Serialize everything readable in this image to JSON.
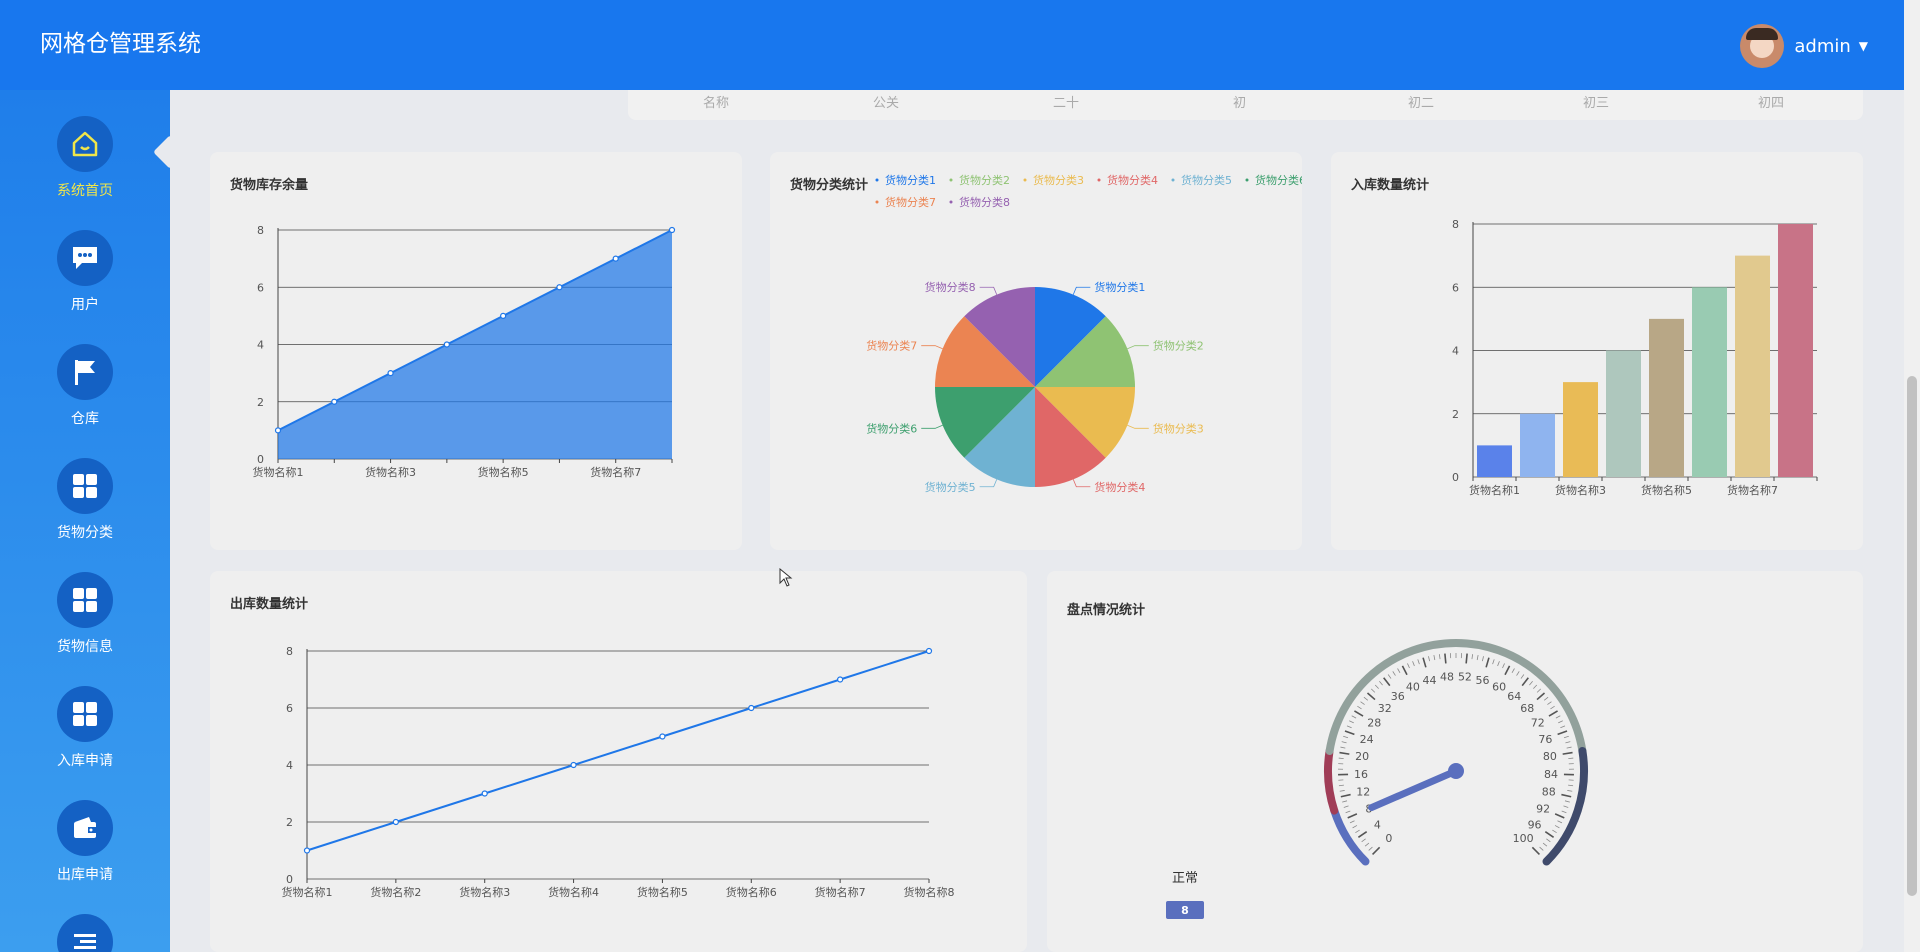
{
  "app": {
    "title": "网格仓管理系统"
  },
  "user": {
    "name": "admin"
  },
  "nav": [
    {
      "label": "系统首页",
      "icon": "home-icon",
      "active": true
    },
    {
      "label": "用户",
      "icon": "chat-icon"
    },
    {
      "label": "仓库",
      "icon": "flag-icon"
    },
    {
      "label": "货物分类",
      "icon": "grid-icon"
    },
    {
      "label": "货物信息",
      "icon": "grid-icon"
    },
    {
      "label": "入库申请",
      "icon": "grid-icon"
    },
    {
      "label": "出库申请",
      "icon": "wallet-icon"
    }
  ],
  "topcard": {
    "cells": [
      "名称",
      "公关",
      "二十",
      "初",
      "初二",
      "初三",
      "初四"
    ]
  },
  "charts": {
    "stock": {
      "title": "货物库存余量"
    },
    "category": {
      "title": "货物分类统计"
    },
    "inbound": {
      "title": "入库数量统计"
    },
    "outbound": {
      "title": "出库数量统计"
    },
    "inventory": {
      "title": "盘点情况统计"
    }
  },
  "chart_data": [
    {
      "type": "area",
      "title": "货物库存余量",
      "x": [
        "货物名称1",
        "货物名称2",
        "货物名称3",
        "货物名称4",
        "货物名称5",
        "货物名称6",
        "货物名称7",
        "货物名称8"
      ],
      "x_tick_labels": [
        "货物名称1",
        "货物名称3",
        "货物名称5",
        "货物名称7"
      ],
      "values": [
        1,
        2,
        3,
        4,
        5,
        6,
        7,
        8
      ],
      "ylim": [
        0,
        8
      ],
      "yticks": [
        0,
        2,
        4,
        6,
        8
      ],
      "color": "#1f77e8"
    },
    {
      "type": "pie",
      "title": "货物分类统计",
      "legend": "top",
      "labels": [
        "货物分类1",
        "货物分类2",
        "货物分类3",
        "货物分类4",
        "货物分类5",
        "货物分类6",
        "货物分类7",
        "货物分类8"
      ],
      "values": [
        1,
        1,
        1,
        1,
        1,
        1,
        1,
        1
      ],
      "colors": [
        "#1f77e8",
        "#8fc373",
        "#eabb50",
        "#e06767",
        "#6fb2d2",
        "#3d9f6e",
        "#eb8452",
        "#9561b0"
      ]
    },
    {
      "type": "bar",
      "title": "入库数量统计",
      "categories": [
        "货物名称1",
        "货物名称2",
        "货物名称3",
        "货物名称4",
        "货物名称5",
        "货物名称6",
        "货物名称7",
        "货物名称8"
      ],
      "x_tick_labels": [
        "货物名称1",
        "货物名称3",
        "货物名称5",
        "货物名称7"
      ],
      "values": [
        1,
        2,
        3,
        4,
        5,
        6,
        7,
        8
      ],
      "ylim": [
        0,
        8
      ],
      "yticks": [
        0,
        2,
        4,
        6,
        8
      ],
      "colors": [
        "#5a82ea",
        "#8fb4ef",
        "#e9bb56",
        "#aec7bd",
        "#b8a786",
        "#99cbb2",
        "#e1c98e",
        "#c87387"
      ]
    },
    {
      "type": "line",
      "title": "出库数量统计",
      "x": [
        "货物名称1",
        "货物名称2",
        "货物名称3",
        "货物名称4",
        "货物名称5",
        "货物名称6",
        "货物名称7",
        "货物名称8"
      ],
      "values": [
        1,
        2,
        3,
        4,
        5,
        6,
        7,
        8
      ],
      "ylim": [
        0,
        8
      ],
      "yticks": [
        0,
        2,
        4,
        6,
        8
      ],
      "color": "#1f77e8"
    },
    {
      "type": "gauge",
      "title": "盘点情况统计",
      "value": 8,
      "min": 0,
      "max": 100,
      "major_ticks": [
        0,
        4,
        8,
        12,
        16,
        20,
        24,
        28,
        32,
        36,
        40,
        44,
        48,
        52,
        56,
        60,
        64,
        68,
        72,
        76,
        80,
        84,
        88,
        92,
        96,
        100
      ],
      "name": "正常",
      "value_label": "8",
      "colors": {
        "low": "#5a6fbe",
        "mid": "#a03d57",
        "track": "#92a19c",
        "high": "#3f4a6b",
        "pointer": "#5a6fbe"
      }
    }
  ]
}
